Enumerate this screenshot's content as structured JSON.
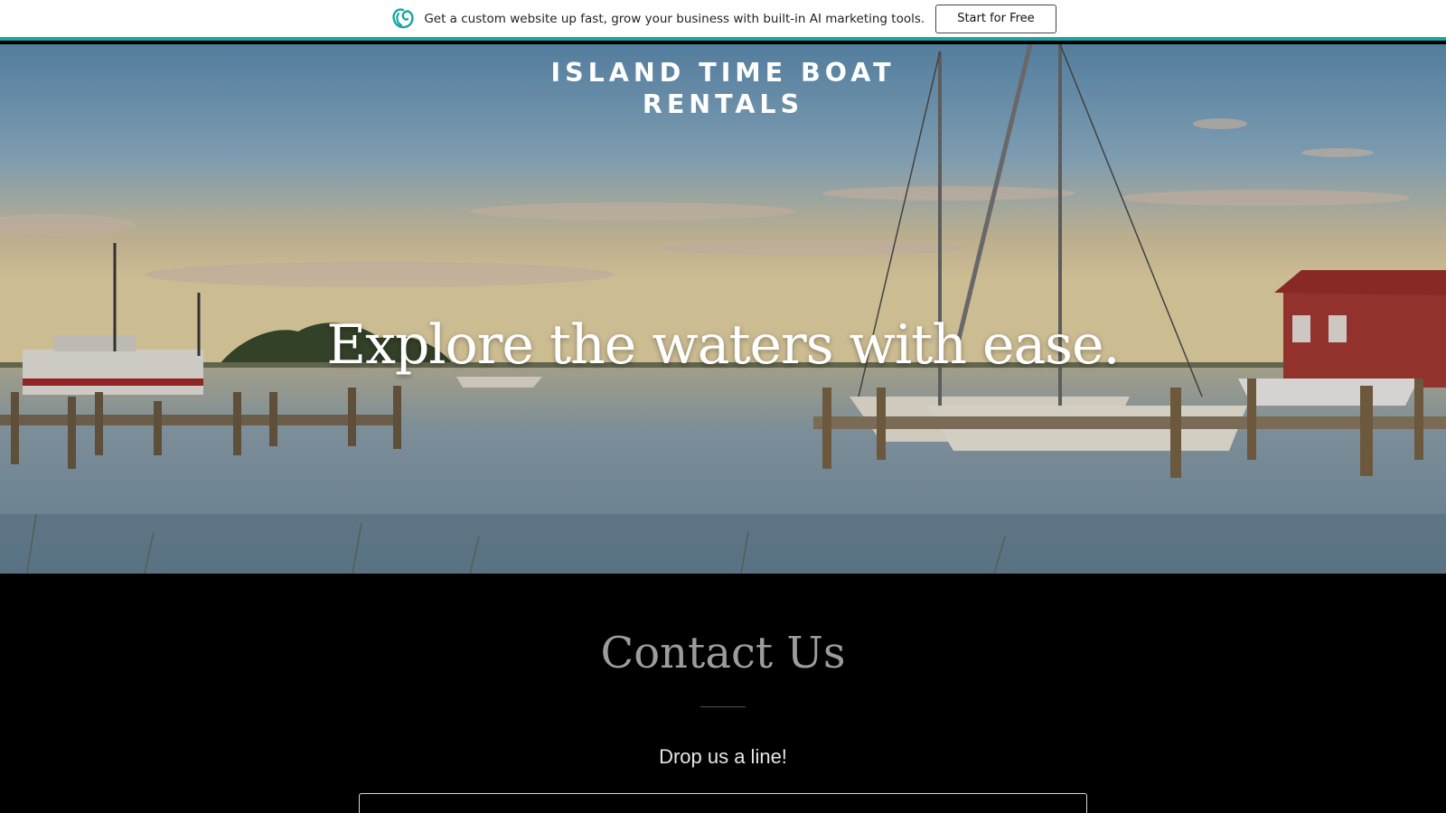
{
  "promo": {
    "logo_icon": "godaddy-logo-icon",
    "text": "Get a custom website up fast, grow your business with built-in AI marketing tools.",
    "button_label": "Start for Free",
    "accent": "#1ba5a2"
  },
  "hero": {
    "site_title_line1": "ISLAND TIME BOAT",
    "site_title_line2": "RENTALS",
    "headline": "Explore the waters with ease."
  },
  "contact": {
    "title": "Contact Us",
    "subtitle": "Drop us a line!"
  }
}
